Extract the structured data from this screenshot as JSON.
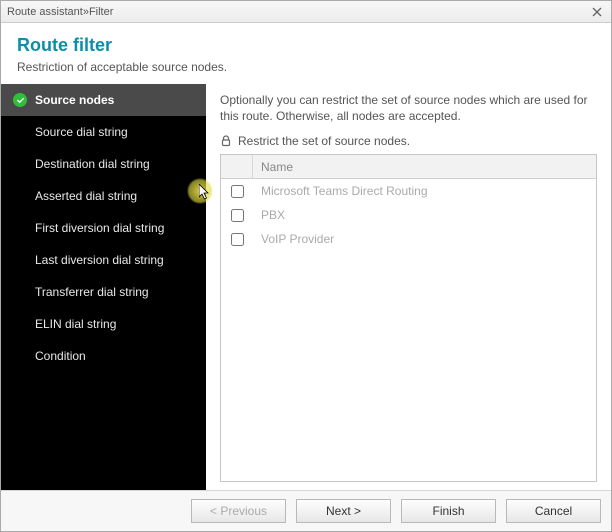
{
  "titlebar": {
    "crumb1": "Route assistant",
    "sep": " » ",
    "crumb2": "Filter"
  },
  "header": {
    "title": "Route filter",
    "subtitle": "Restriction of acceptable source nodes."
  },
  "sidebar": {
    "items": [
      {
        "label": "Source nodes",
        "selected": true
      },
      {
        "label": "Source dial string",
        "selected": false
      },
      {
        "label": "Destination dial string",
        "selected": false
      },
      {
        "label": "Asserted dial string",
        "selected": false
      },
      {
        "label": "First diversion dial string",
        "selected": false
      },
      {
        "label": "Last diversion dial string",
        "selected": false
      },
      {
        "label": "Transferrer dial string",
        "selected": false
      },
      {
        "label": "ELIN dial string",
        "selected": false
      },
      {
        "label": "Condition",
        "selected": false
      }
    ]
  },
  "main": {
    "description": "Optionally you can restrict the set of source nodes which are used for this route. Otherwise, all nodes are accepted.",
    "restrict_label": "Restrict the set of source nodes.",
    "table": {
      "header": {
        "name": "Name"
      },
      "rows": [
        {
          "name": "Microsoft Teams Direct Routing",
          "checked": false
        },
        {
          "name": "PBX",
          "checked": false
        },
        {
          "name": "VoIP Provider",
          "checked": false
        }
      ]
    }
  },
  "footer": {
    "previous": "< Previous",
    "next": "Next >",
    "finish": "Finish",
    "cancel": "Cancel"
  }
}
